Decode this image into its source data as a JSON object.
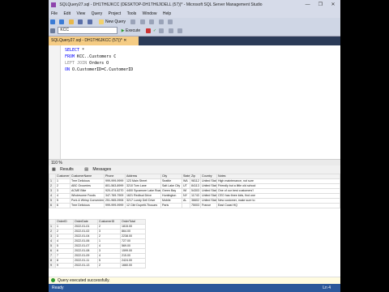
{
  "titlebar": {
    "title": "SQLQuery27.sql - DH1TH6JKCC (DESKTOP-DH1TH6J\\DELL (57))* - Microsoft SQL Server Management Studio",
    "controls": [
      "—",
      "❐",
      "✕"
    ]
  },
  "menubar": {
    "items": [
      "File",
      "Edit",
      "View",
      "Query",
      "Project",
      "Tools",
      "Window",
      "Help"
    ]
  },
  "toolbar1": {
    "new_query": "New Query"
  },
  "toolbar2": {
    "database": "KCC",
    "execute": "Execute"
  },
  "tab": {
    "label": "SQLQuery27.sql - DH1TH6JKCC (57))* ✕"
  },
  "code": {
    "lines": [
      [
        "SELECT *"
      ],
      [
        "FROM KCC..Customers C"
      ],
      [
        "LEFT JOIN Orders O"
      ],
      [
        "ON O.CustomerID=C.CustomerID"
      ]
    ]
  },
  "zoom": "110 %",
  "resulttabs": {
    "results": "Results",
    "messages": "Messages"
  },
  "grid1": {
    "headers": [
      "CustomerID",
      "CustomerName",
      "Phone",
      "Address",
      "City",
      "State",
      "Zip",
      "Country",
      "Notes"
    ],
    "rows": [
      [
        "1",
        "1",
        "Tree Delicious",
        "999-999-9999",
        "123 Main Street",
        "Seattle",
        "WA",
        "98112",
        "United States",
        "High maintenance, not sure"
      ],
      [
        "2",
        "2",
        "ABC Groceries",
        "801-563-8999",
        "3210 Tom Lane",
        "Salt Lake City",
        "UT",
        "84113",
        "United States",
        "Friendly but a little old school"
      ],
      [
        "3",
        "3",
        "ACME Bike",
        "920-474-6270",
        "4400 Sycamore Lake Road",
        "Green Bay",
        "WI",
        "54303",
        "United States",
        "One of our best customers'!"
      ],
      [
        "4",
        "4",
        "Wholesome Foods",
        "347-769-7909",
        "1621 Redbud Drive",
        "Huntington",
        "NY",
        "11743",
        "United States",
        "CEO has three kids, find one"
      ],
      [
        "5",
        "5",
        "Pork & Whisp Convenience Stores",
        "251-965-0906",
        "3217 Lundy Dell Drive",
        "Mobile",
        "AL",
        "36602",
        "United States",
        "New customer, make sure to"
      ],
      [
        "6",
        "6",
        "Tree Delicious",
        "999-999-9999",
        "12 Cité Dupetit-Thouars",
        "Paris",
        "",
        "75003",
        "France",
        "East Coast HQ"
      ]
    ]
  },
  "grid2": {
    "headers": [
      "OrderID",
      "OrderDate",
      "CustomerID",
      "OrderTotal"
    ],
    "rows": [
      [
        "1",
        "1",
        "2022-01-01",
        "2",
        "1815.00"
      ],
      [
        "2",
        "2",
        "2022-01-02",
        "3",
        "864.00"
      ],
      [
        "3",
        "3",
        "2022-01-04",
        "2",
        "2238.00"
      ],
      [
        "4",
        "4",
        "2022-01-06",
        "1",
        "727.00"
      ],
      [
        "5",
        "5",
        "2022-01-07",
        "4",
        "569.00"
      ],
      [
        "6",
        "6",
        "2022-01-08",
        "3",
        "1599.00"
      ],
      [
        "7",
        "7",
        "2022-01-09",
        "4",
        "215.00"
      ],
      [
        "8",
        "8",
        "2022-01-11",
        "5",
        "2424.00"
      ],
      [
        "9",
        "9",
        "2022-01-13",
        "2",
        "1660.00"
      ]
    ]
  },
  "status": {
    "message": "Query executed successfully."
  },
  "bottombar": {
    "left": "Ready",
    "right": "Ln 4"
  }
}
